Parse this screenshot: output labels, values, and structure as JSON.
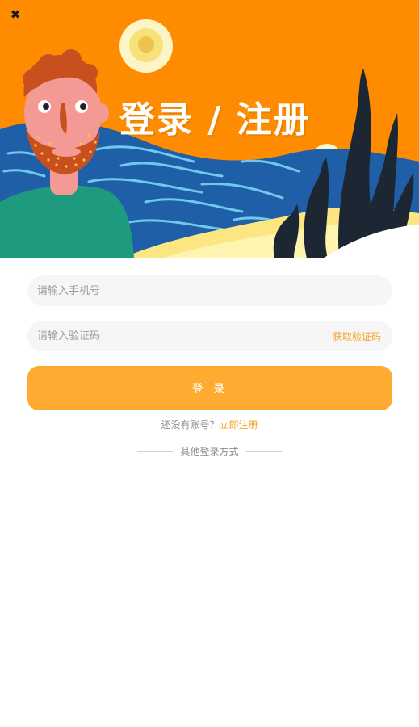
{
  "header": {
    "title": "登录 / 注册",
    "close_icon": "close-icon"
  },
  "form": {
    "phone_placeholder": "请输入手机号",
    "code_placeholder": "请输入验证码",
    "get_code_label": "获取验证码",
    "login_label": "登 录"
  },
  "register": {
    "prompt": "还没有账号？",
    "link": "立即注册"
  },
  "other_login": {
    "label": "其他登录方式"
  },
  "colors": {
    "accent": "#ffaa30",
    "link": "#f5a42a",
    "banner": "#ff8c00"
  }
}
